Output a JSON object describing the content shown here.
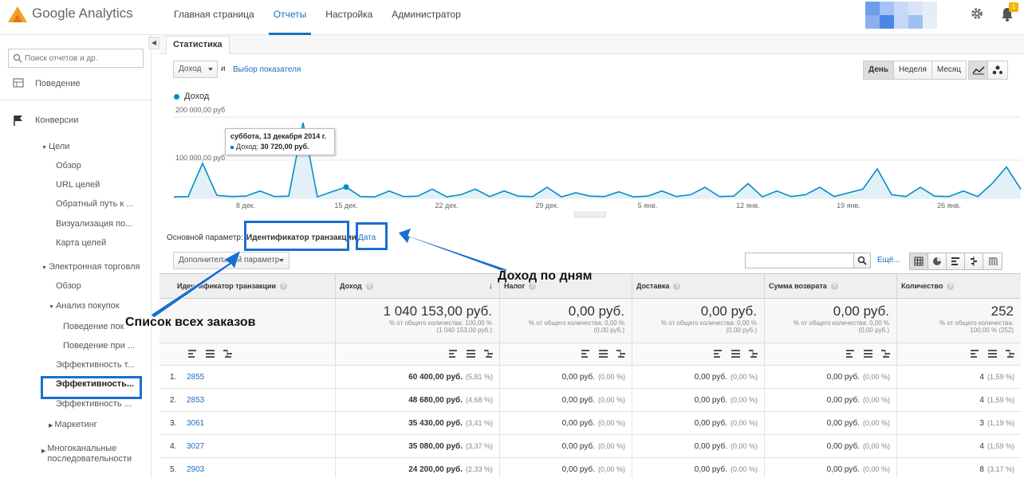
{
  "app": {
    "logo_text": "Google Analytics"
  },
  "nav": [
    {
      "label": "Главная страница",
      "active": false
    },
    {
      "label": "Отчеты",
      "active": true
    },
    {
      "label": "Настройка",
      "active": false
    },
    {
      "label": "Администратор",
      "active": false
    }
  ],
  "notifications": {
    "count": "1"
  },
  "colors": {
    "accent": "#1a73b8",
    "series": "#058dc7",
    "annotation": "#1a6fd0",
    "avatar": [
      "#6d9eeb",
      "#a4c2f4",
      "#c9daf8",
      "#d9e5f7",
      "#e4ecf7",
      "#8ab0ee",
      "#4a86e8",
      "#c5d7f5",
      "#9fc0f2",
      "#e9eff9"
    ]
  },
  "sidebar": {
    "search_placeholder": "Поиск отчетов и др.",
    "items": {
      "behavior": "Поведение",
      "conversions": "Конверсии",
      "goals": "Цели",
      "goals_overview": "Обзор",
      "goals_urls": "URL целей",
      "goals_reverse": "Обратный путь к ...",
      "goals_funnel": "Визуализация по...",
      "goals_flow": "Карта целей",
      "ecommerce": "Электронная торговля",
      "ec_overview": "Обзор",
      "shopping": "Анализ покупок",
      "shopping_behavior": "Поведение пок",
      "checkout_behavior": "Поведение при ...",
      "product_perf": "Эффективность т...",
      "sales_perf": "Эффективность...",
      "product_list_perf": "Эффективность ...",
      "marketing": "Маркетинг",
      "multichannel": "Многоканальные последовательности"
    }
  },
  "tabs": {
    "stats": "Статистика"
  },
  "toolbar": {
    "metric_select": "Доход",
    "and_text": "и",
    "metric_link": "Выбор показателя",
    "periods": [
      {
        "label": "День",
        "active": true
      },
      {
        "label": "Неделя",
        "active": false
      },
      {
        "label": "Месяц",
        "active": false
      }
    ]
  },
  "chart_data": {
    "type": "line",
    "legend": "Доход",
    "yticks": [
      "200 000,00 руб",
      "100 000,00 руб"
    ],
    "ylim": [
      0,
      220000
    ],
    "xtick_labels": [
      {
        "label": "8 дек.",
        "index": 5
      },
      {
        "label": "15 дек.",
        "index": 12
      },
      {
        "label": "22 дек.",
        "index": 19
      },
      {
        "label": "29 дек.",
        "index": 26
      },
      {
        "label": "5 янв.",
        "index": 33
      },
      {
        "label": "12 янв.",
        "index": 40
      },
      {
        "label": "19 янв.",
        "index": 47
      },
      {
        "label": "26 янв.",
        "index": 54
      }
    ],
    "values": [
      4000,
      5000,
      95000,
      8000,
      5000,
      6000,
      20000,
      5000,
      6000,
      205000,
      4000,
      18000,
      30720,
      5000,
      4000,
      20000,
      5000,
      6000,
      25000,
      4000,
      10000,
      25000,
      5000,
      20000,
      6000,
      5000,
      30000,
      4000,
      15000,
      6000,
      5000,
      18000,
      4000,
      6000,
      20000,
      5000,
      10000,
      30000,
      5000,
      6000,
      40000,
      4000,
      20000,
      5000,
      10000,
      30000,
      5000,
      15000,
      25000,
      80000,
      10000,
      5000,
      30000,
      6000,
      5000,
      20000,
      5000,
      40000,
      85000,
      25000
    ],
    "highlight_index": 12,
    "tooltip": {
      "title": "суббота, 13 декабря 2014 г.",
      "label": "Доход:",
      "value": "30 720,00 руб."
    }
  },
  "dimension": {
    "label": "Основной параметр:",
    "active": "Идентификатор транзакции",
    "date": "Дата"
  },
  "secondary_dim": "Дополнительный параметр",
  "table_more": "Ещё...",
  "table": {
    "headers": [
      "Идентификатор транзакции",
      "Доход",
      "Налог",
      "Доставка",
      "Сумма возврата",
      "Количество"
    ],
    "totals": [
      {
        "value": "1 040 153,00 руб.",
        "line1": "% от общего количества: 100,00 %",
        "line2": "(1 040 153,00 руб.)"
      },
      {
        "value": "0,00 руб.",
        "line1": "% от общего количества: 0,00 %",
        "line2": "(0,00 руб.)"
      },
      {
        "value": "0,00 руб.",
        "line1": "% от общего количества: 0,00 %",
        "line2": "(0,00 руб.)"
      },
      {
        "value": "0,00 руб.",
        "line1": "% от общего количества: 0,00 %",
        "line2": "(0,00 руб.)"
      },
      {
        "value": "252",
        "line1": "% от общего количества:",
        "line2": "100,00 % (252)"
      }
    ],
    "rows": [
      {
        "n": "1.",
        "id": "2855",
        "revenue": "60 400,00 руб.",
        "revenue_pct": "(5,81 %)",
        "tax": "0,00 руб.",
        "tax_pct": "(0,00 %)",
        "ship": "0,00 руб.",
        "ship_pct": "(0,00 %)",
        "refund": "0,00 руб.",
        "refund_pct": "(0,00 %)",
        "qty": "4",
        "qty_pct": "(1,59 %)"
      },
      {
        "n": "2.",
        "id": "2853",
        "revenue": "48 680,00 руб.",
        "revenue_pct": "(4,68 %)",
        "tax": "0,00 руб.",
        "tax_pct": "(0,00 %)",
        "ship": "0,00 руб.",
        "ship_pct": "(0,00 %)",
        "refund": "0,00 руб.",
        "refund_pct": "(0,00 %)",
        "qty": "4",
        "qty_pct": "(1,59 %)"
      },
      {
        "n": "3.",
        "id": "3061",
        "revenue": "35 430,00 руб.",
        "revenue_pct": "(3,41 %)",
        "tax": "0,00 руб.",
        "tax_pct": "(0,00 %)",
        "ship": "0,00 руб.",
        "ship_pct": "(0,00 %)",
        "refund": "0,00 руб.",
        "refund_pct": "(0,00 %)",
        "qty": "3",
        "qty_pct": "(1,19 %)"
      },
      {
        "n": "4.",
        "id": "3027",
        "revenue": "35 080,00 руб.",
        "revenue_pct": "(3,37 %)",
        "tax": "0,00 руб.",
        "tax_pct": "(0,00 %)",
        "ship": "0,00 руб.",
        "ship_pct": "(0,00 %)",
        "refund": "0,00 руб.",
        "refund_pct": "(0,00 %)",
        "qty": "4",
        "qty_pct": "(1,59 %)"
      },
      {
        "n": "5.",
        "id": "2903",
        "revenue": "24 200,00 руб.",
        "revenue_pct": "(2,33 %)",
        "tax": "0,00 руб.",
        "tax_pct": "(0,00 %)",
        "ship": "0,00 руб.",
        "ship_pct": "(0,00 %)",
        "refund": "0,00 руб.",
        "refund_pct": "(0,00 %)",
        "qty": "8",
        "qty_pct": "(3,17 %)"
      }
    ]
  },
  "annotations": {
    "daily_revenue": "Доход по дням",
    "all_orders": "Список всех заказов"
  }
}
